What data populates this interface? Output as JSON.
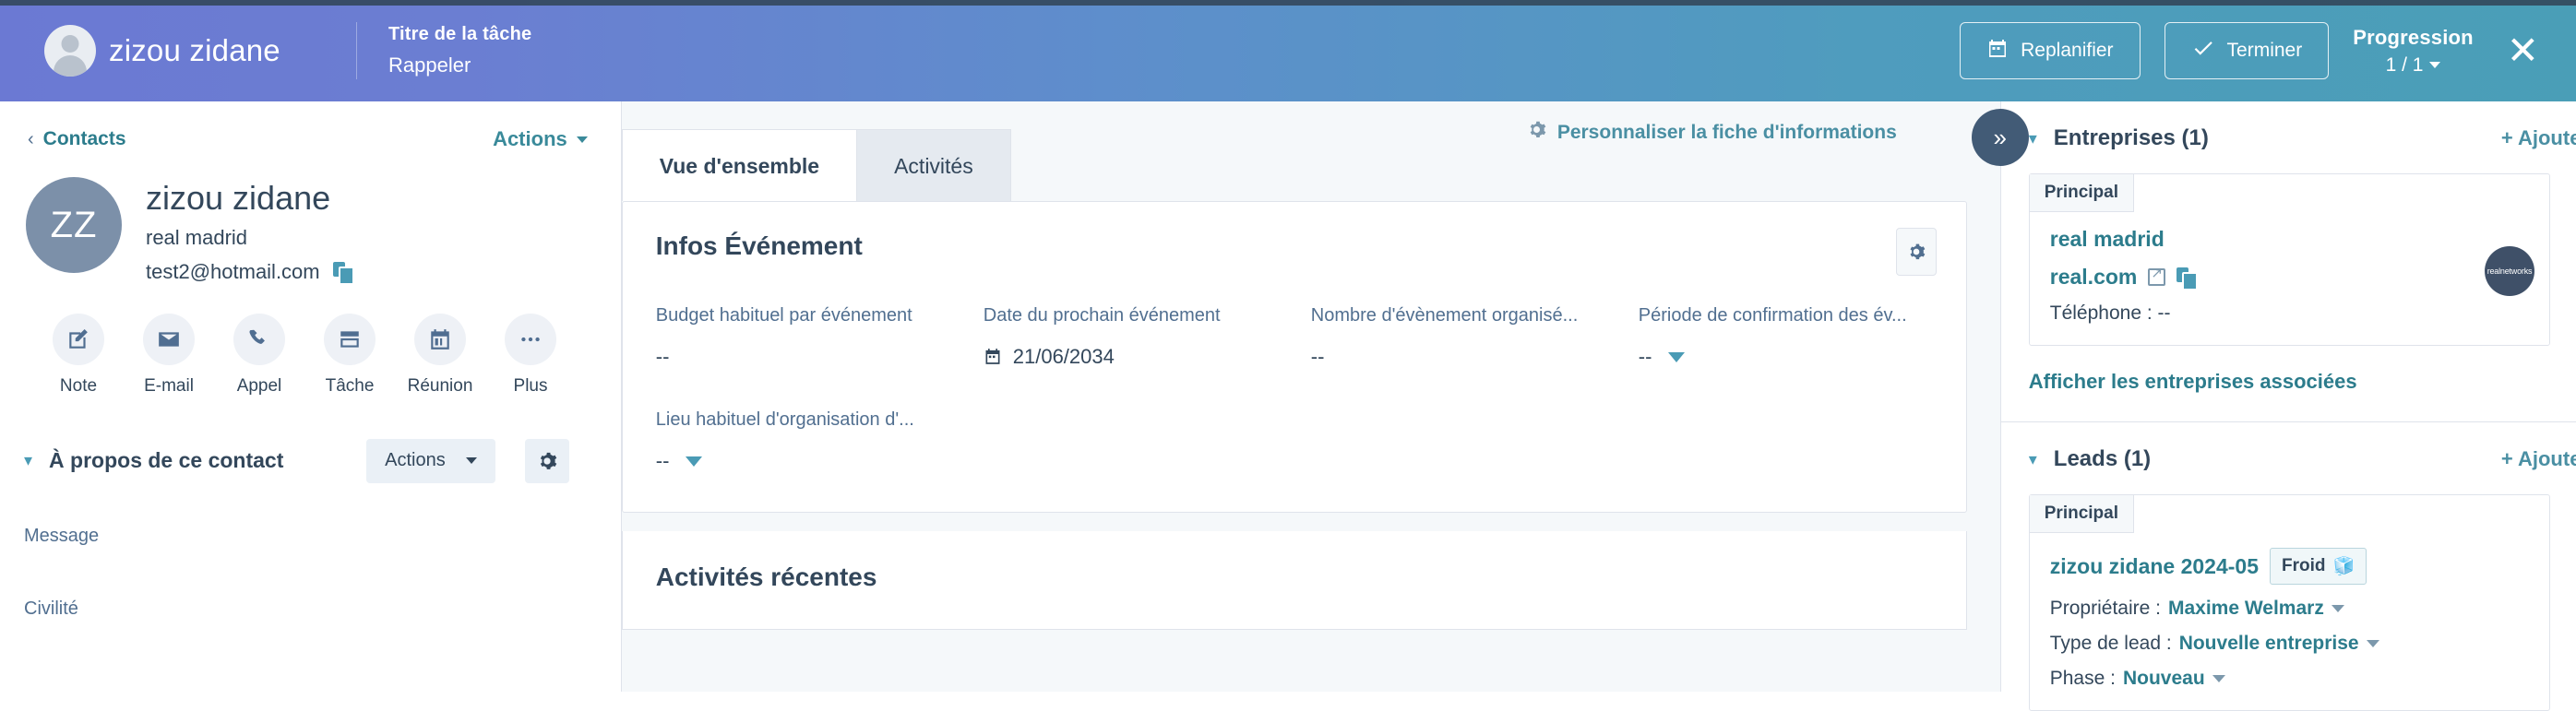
{
  "taskbar": {
    "contact_name": "zizou zidane",
    "avatar_icon": "user-avatar-icon",
    "task_label": "Titre de la tâche",
    "task_value": "Rappeler",
    "reschedule_label": "Replanifier",
    "reschedule_icon": "calendar-icon",
    "complete_label": "Terminer",
    "complete_icon": "check-icon",
    "progress_label": "Progression",
    "progress_value": "1 / 1",
    "close_icon": "close-icon",
    "gradient_start": "#6b79d3",
    "gradient_end": "#4a9eb7"
  },
  "left": {
    "back_label": "Contacts",
    "back_icon": "chevron-left-icon",
    "actions_label": "Actions",
    "avatar_initials": "ZZ",
    "name": "zizou zidane",
    "company": "real madrid",
    "email": "test2@hotmail.com",
    "copy_icon": "copy-icon",
    "quick_actions": [
      {
        "label": "Note",
        "icon": "note-edit-icon"
      },
      {
        "label": "E-mail",
        "icon": "envelope-icon"
      },
      {
        "label": "Appel",
        "icon": "phone-icon"
      },
      {
        "label": "Tâche",
        "icon": "task-icon"
      },
      {
        "label": "Réunion",
        "icon": "calendar-meeting-icon"
      },
      {
        "label": "Plus",
        "icon": "ellipsis-icon"
      }
    ],
    "about_title": "À propos de ce contact",
    "about_actions_label": "Actions",
    "about_gear_icon": "gear-icon",
    "fields": [
      {
        "label": "Message"
      },
      {
        "label": "Civilité"
      }
    ]
  },
  "middle": {
    "tabs": [
      {
        "label": "Vue d'ensemble",
        "active": true
      },
      {
        "label": "Activités",
        "active": false
      }
    ],
    "customize_label": "Personnaliser la fiche d'informations",
    "customize_icon": "gear-icon",
    "collapse_icon": "double-chevron-right-icon",
    "event_card": {
      "title": "Infos Événement",
      "gear_icon": "gear-icon",
      "fields": [
        {
          "label": "Budget habituel par événement",
          "value": "--",
          "icon": "",
          "dropdown": false
        },
        {
          "label": "Date du prochain événement",
          "value": "21/06/2034",
          "icon": "calendar-icon",
          "dropdown": false
        },
        {
          "label": "Nombre d'évènement organisé...",
          "value": "--",
          "icon": "",
          "dropdown": false
        },
        {
          "label": "Période de confirmation des év...",
          "value": "--",
          "icon": "",
          "dropdown": true
        }
      ],
      "secondary_field": {
        "label": "Lieu habituel d'organisation d'...",
        "value": "--",
        "dropdown": true
      }
    },
    "recent_card": {
      "title": "Activités récentes"
    }
  },
  "right": {
    "companies": {
      "title": "Entreprises (1)",
      "add_label": "+ Ajouter",
      "chevron_icon": "chevron-down-icon",
      "tag": "Principal",
      "name": "real madrid",
      "website": "real.com",
      "external_icon": "external-link-icon",
      "copy_icon": "copy-icon",
      "phone_line": "Téléphone : --",
      "logo_text": "realnetworks",
      "show_associated": "Afficher les entreprises associées"
    },
    "leads": {
      "title": "Leads (1)",
      "add_label": "+ Ajouter",
      "chevron_icon": "chevron-down-icon",
      "tag": "Principal",
      "name": "zizou zidane 2024-05",
      "badge": "Froid",
      "badge_icon": "ice-cube-icon",
      "rows": [
        {
          "key": "Propriétaire :",
          "value": "Maxime Welmarz"
        },
        {
          "key": "Type de lead :",
          "value": "Nouvelle entreprise"
        },
        {
          "key": "Phase :",
          "value": "Nouveau"
        }
      ]
    }
  }
}
